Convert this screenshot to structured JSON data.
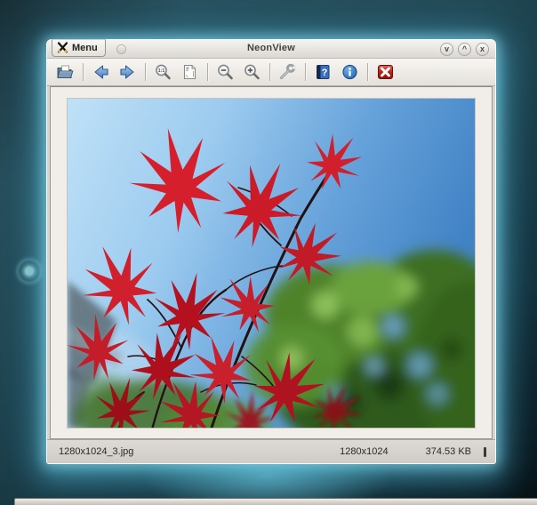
{
  "window": {
    "title": "NeonView",
    "menu_label": "Menu",
    "controls": [
      {
        "name": "shade-button",
        "glyph": "v"
      },
      {
        "name": "unshade-button",
        "glyph": "^"
      },
      {
        "name": "close-button",
        "glyph": "x"
      }
    ]
  },
  "toolbar": {
    "icons": [
      "open-file",
      "go-previous",
      "go-next",
      "zoom-original",
      "fit-to-window",
      "zoom-out",
      "zoom-in",
      "settings",
      "help",
      "about",
      "quit"
    ]
  },
  "statusbar": {
    "filename": "1280x1024_3.jpg",
    "dimensions": "1280x1024",
    "filesize": "374.53 KB"
  },
  "photo": {
    "description": "Red Japanese maple leaves and thin dark branches against a blue sky, with a blurred green tree on the right"
  },
  "colors": {
    "glow": "#7fdcf2",
    "leaf_red": "#cc1b28",
    "sky_light": "#bcdff6",
    "sky_deep": "#4687c9",
    "tree_green": "#3f6e24",
    "close_red": "#b81f14",
    "accent_blue": "#2a6bb8"
  }
}
